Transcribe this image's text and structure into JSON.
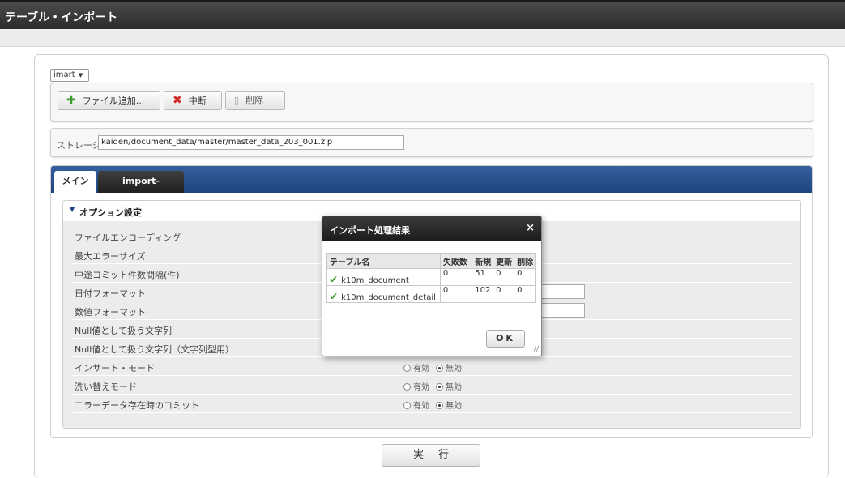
{
  "header": {
    "title": "テーブル・インポート"
  },
  "selector": {
    "value": "imart"
  },
  "toolbar": {
    "add_label": "ファイル追加...",
    "stop_label": "中断",
    "delete_label": "削除"
  },
  "storage": {
    "label": "ストレージ",
    "path": "kaiden/document_data/master/master_data_203_001.zip"
  },
  "tabs": [
    {
      "label": "メイン",
      "active": true
    },
    {
      "label": "import-option.xml",
      "active": false
    }
  ],
  "options": {
    "heading": "オプション設定",
    "rows": [
      {
        "label": "ファイルエンコーディング"
      },
      {
        "label": "最大エラーサイズ"
      },
      {
        "label": "中途コミット件数間隔(件)"
      },
      {
        "label": "日付フォーマット"
      },
      {
        "label": "数値フォーマット"
      },
      {
        "label": "Null値として扱う文字列"
      },
      {
        "label": "Null値として扱う文字列（文字列型用）"
      },
      {
        "label": "インサート・モード",
        "radio": {
          "on_label": "有効",
          "off_label": "無効",
          "selected": "無効"
        }
      },
      {
        "label": "洗い替えモード",
        "radio": {
          "on_label": "有効",
          "off_label": "無効",
          "selected": "無効"
        }
      },
      {
        "label": "エラーデータ存在時のコミット",
        "radio": {
          "on_label": "有効",
          "off_label": "無効",
          "selected": "無効"
        }
      }
    ]
  },
  "run_button": {
    "label": "実行"
  },
  "dialog": {
    "title": "インポート処理結果",
    "close": "×",
    "columns": [
      "テーブル名",
      "失敗数",
      "新規",
      "更新",
      "削除"
    ],
    "rows": [
      {
        "name": "k10m_document",
        "failed": "0",
        "new": "51",
        "updated": "0",
        "deleted": "0"
      },
      {
        "name": "k10m_document_detail",
        "failed": "0",
        "new": "102",
        "updated": "0",
        "deleted": "0"
      }
    ],
    "ok_label": "OK"
  },
  "colors": {
    "accent": "#1d4580",
    "titlebar": "#2b2b2b",
    "success": "#3a9a2a",
    "danger": "#d62b2b"
  }
}
